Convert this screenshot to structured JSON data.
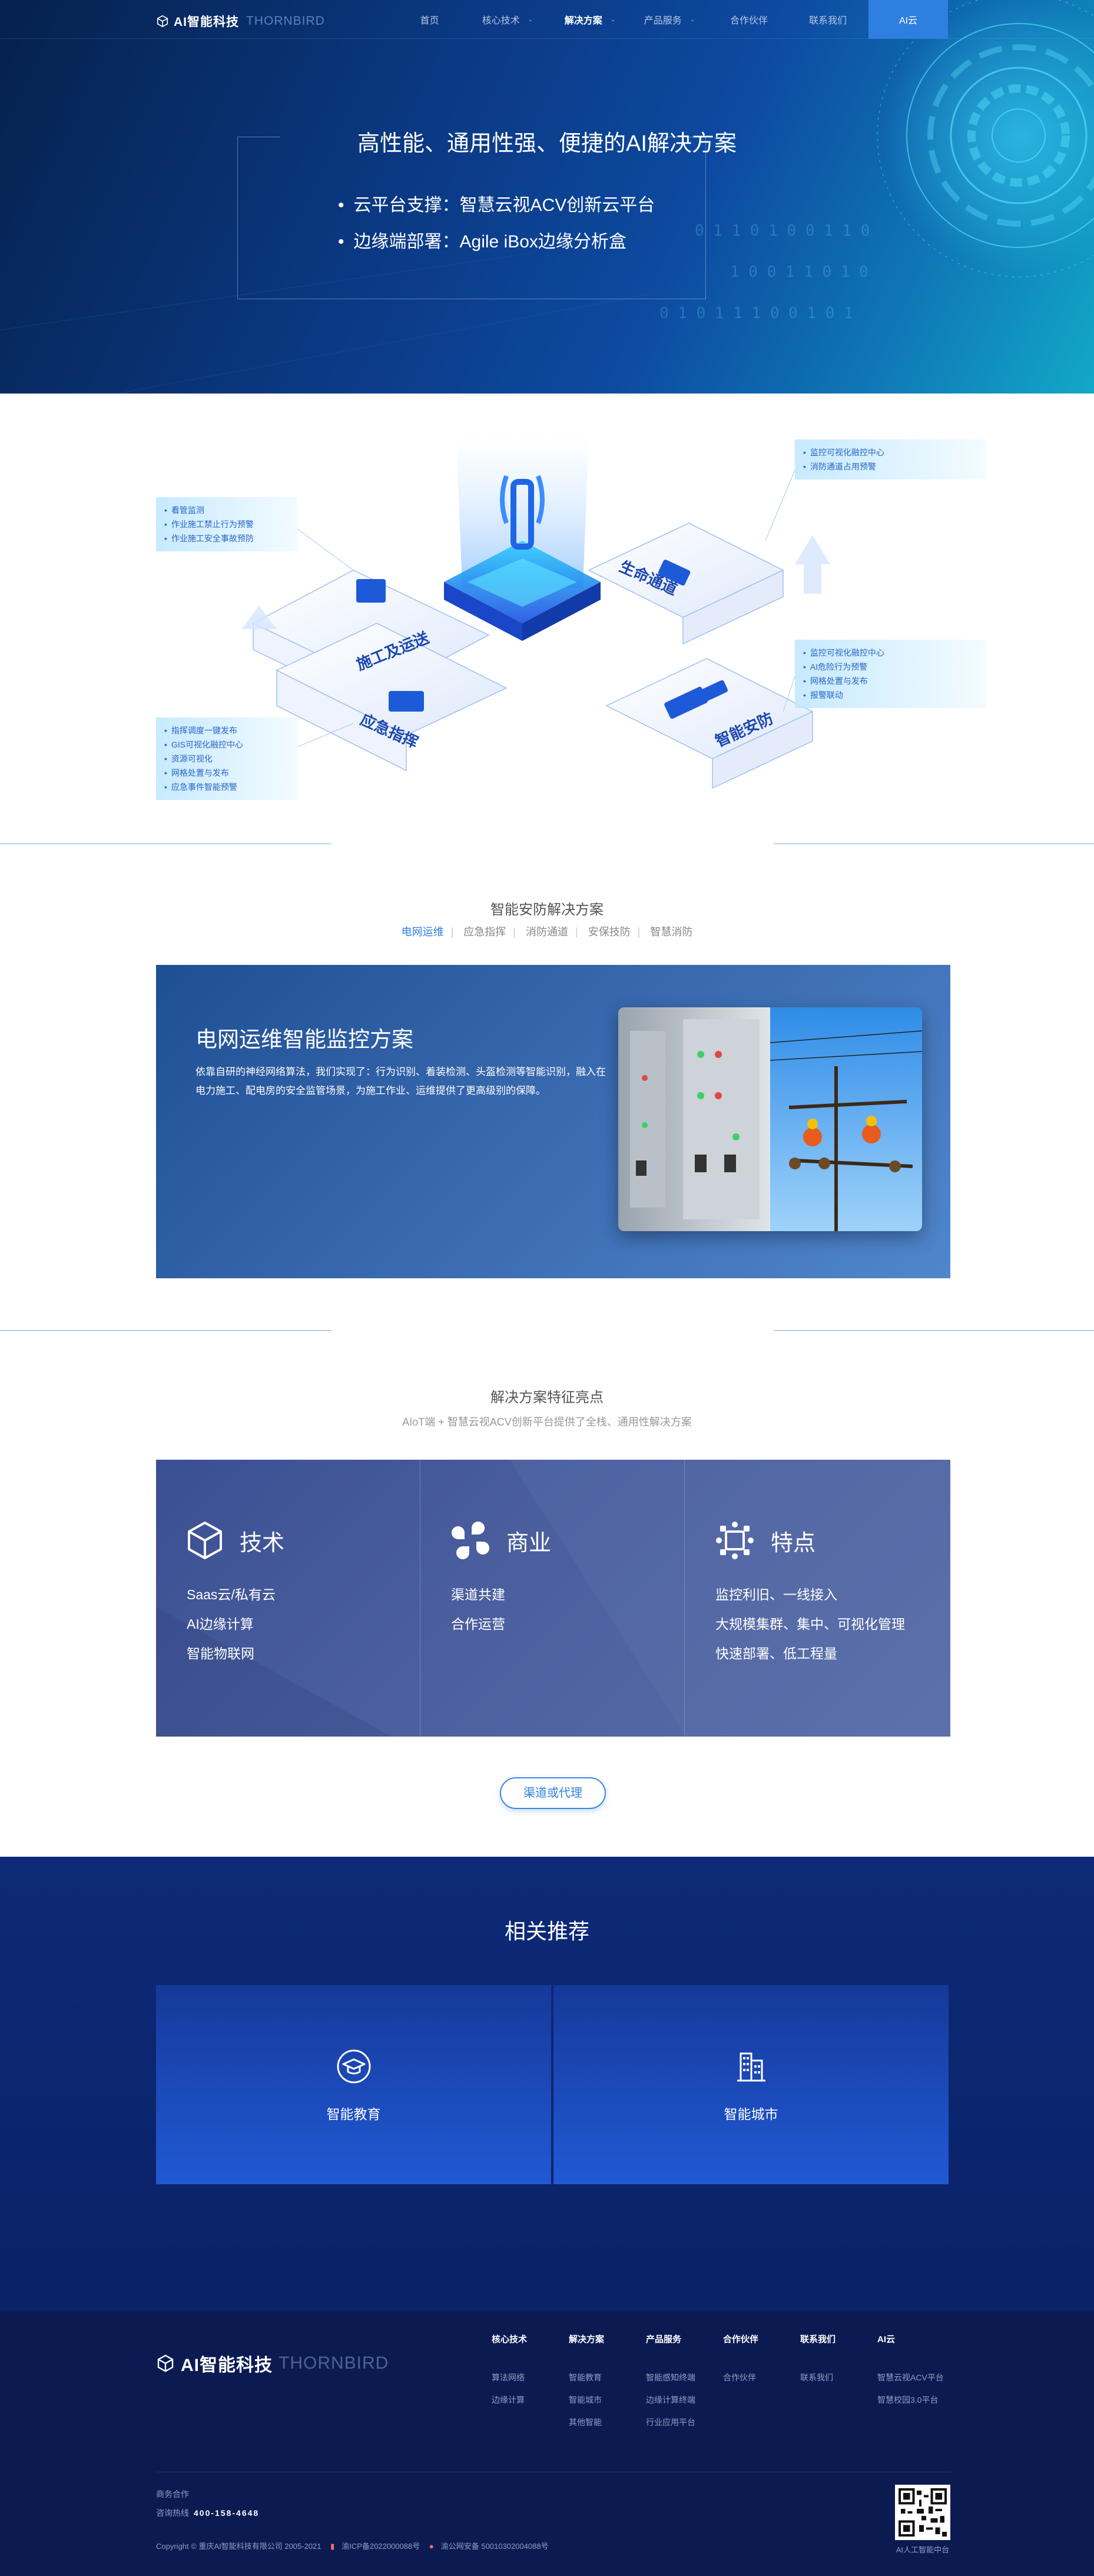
{
  "nav": {
    "logo_text": "AI智能科技",
    "logo_sub": "THORNBIRD",
    "items": [
      {
        "label": "首页"
      },
      {
        "label": "核心技术"
      },
      {
        "label": "解决方案"
      },
      {
        "label": "产品服务"
      },
      {
        "label": "合作伙伴"
      },
      {
        "label": "联系我们"
      },
      {
        "label": "AI云"
      }
    ]
  },
  "hero": {
    "title": "高性能、通用性强、便捷的AI解决方案",
    "bullets": [
      "云平台支撑：智慧云视ACV创新云平台",
      "边缘端部署：Agile iBox边缘分析盒"
    ]
  },
  "diagram": {
    "labels": [
      "施工及运送",
      "生命通道",
      "应急指挥",
      "智能安防"
    ],
    "tips": {
      "left_top": [
        "看管监测",
        "作业施工禁止行为预警",
        "作业施工安全事故预防"
      ],
      "left_bottom": [
        "指挥调度一键发布",
        "GIS可视化融控中心",
        "资源可视化",
        "网格处置与发布",
        "应急事件智能预警"
      ],
      "right_top": [
        "监控可视化融控中心",
        "消防通道占用预警"
      ],
      "right_bottom": [
        "监控可视化融控中心",
        "AI危险行为预警",
        "网格处置与发布",
        "报警联动"
      ]
    }
  },
  "solutions": {
    "title": "智能安防解决方案",
    "tabs": [
      "电网运维",
      "应急指挥",
      "消防通道",
      "安保技防",
      "智慧消防"
    ],
    "case_title": "电网运维智能监控方案",
    "case_desc": "依靠自研的神经网络算法，我们实现了：行为识别、着装检测、头盔检测等智能识别，融入在电力施工、配电房的安全监管场景，为施工作业、运维提供了更高级别的保障。"
  },
  "features": {
    "title": "解决方案特征亮点",
    "subtitle": "AIoT端 + 智慧云视ACV创新平台提供了全栈、通用性解决方案",
    "columns": [
      {
        "icon": "cube-icon",
        "title": "技术",
        "items": [
          "Saas云/私有云",
          "AI边缘计算",
          "智能物联网"
        ]
      },
      {
        "icon": "clover-icon",
        "title": "商业",
        "items": [
          "渠道共建",
          "合作运营"
        ]
      },
      {
        "icon": "modules-icon",
        "title": "特点",
        "items": [
          "监控利旧、一线接入",
          "大规模集群、集中、可视化管理",
          "快速部署、低工程量"
        ]
      }
    ],
    "button": "渠道或代理"
  },
  "recommend": {
    "title": "相关推荐",
    "cards": [
      {
        "icon": "graduation-icon",
        "label": "智能教育"
      },
      {
        "icon": "buildings-icon",
        "label": "智能城市"
      }
    ]
  },
  "footer": {
    "logo_text": "AI智能科技",
    "logo_sub": "THORNBIRD",
    "columns": [
      {
        "title": "核心技术",
        "items": [
          "算法网络",
          "边缘计算"
        ]
      },
      {
        "title": "解决方案",
        "items": [
          "智能教育",
          "智能城市",
          "其他智能"
        ]
      },
      {
        "title": "产品服务",
        "items": [
          "智能感知终端",
          "边缘计算终端",
          "行业应用平台"
        ]
      },
      {
        "title": "合作伙伴",
        "items": [
          "合作伙伴"
        ]
      },
      {
        "title": "联系我们",
        "items": [
          "联系我们"
        ]
      },
      {
        "title": "AI云",
        "items": [
          "智慧云视ACV平台",
          "智慧校园3.0平台"
        ]
      }
    ],
    "contact_label": "商务合作",
    "phone_label": "咨询热线",
    "phone": "400-158-4648",
    "copyright": "Copyright © 重庆AI智能科技有限公司 2005-2021",
    "icp": "渝ICP备2022000088号",
    "police": "渝公网安备 50010302004088号",
    "qr_label": "AI人工智能中台"
  },
  "colors": {
    "accent": "#2f7fe0",
    "hero_dark": "#05214c",
    "footer_bg": "#0b1b52",
    "recommend_bg": "#0d2a78"
  }
}
